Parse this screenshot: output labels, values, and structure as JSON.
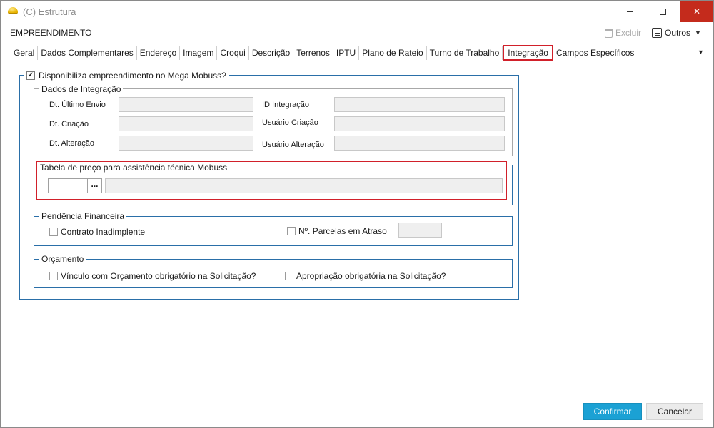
{
  "window": {
    "title": "(C) Estrutura",
    "controls": {
      "minimize": "minimize",
      "maximize": "maximize",
      "close": "✕"
    }
  },
  "header": {
    "entity": "EMPREENDIMENTO",
    "excluir": "Excluir",
    "outros": "Outros"
  },
  "tabs": [
    {
      "label": "Geral"
    },
    {
      "label": "Dados Complementares"
    },
    {
      "label": "Endereço"
    },
    {
      "label": "Imagem"
    },
    {
      "label": "Croqui"
    },
    {
      "label": "Descrição"
    },
    {
      "label": "Terrenos"
    },
    {
      "label": "IPTU"
    },
    {
      "label": "Plano de Rateio"
    },
    {
      "label": "Turno de Trabalho"
    },
    {
      "label": "Integração",
      "active": true
    },
    {
      "label": "Campos Específicos"
    }
  ],
  "main": {
    "mobuss_toggle": {
      "label": "Disponibiliza empreendimento no Mega Mobuss?",
      "checked": true
    },
    "integration": {
      "title": "Dados de Integração",
      "dt_ultimo_envio": {
        "label": "Dt. Último Envio",
        "value": ""
      },
      "dt_criacao": {
        "label": "Dt. Criação",
        "value": ""
      },
      "dt_alteracao": {
        "label": "Dt. Alteração",
        "value": ""
      },
      "id_integracao": {
        "label": "ID Integração",
        "value": ""
      },
      "usuario_criacao": {
        "label": "Usuário Criação",
        "value": ""
      },
      "usuario_alteracao": {
        "label": "Usuário Alteração",
        "value": ""
      }
    },
    "price_table": {
      "title": "Tabela de preço para assistência técnica Mobuss",
      "code": "",
      "lookup_button": "...",
      "description": ""
    },
    "financial": {
      "title": "Pendência Financeira",
      "contrato_inadimplente": {
        "label": "Contrato Inadimplente",
        "checked": false
      },
      "parcelas_atraso": {
        "label": "Nº. Parcelas em Atraso",
        "checked": false,
        "value": ""
      }
    },
    "budget": {
      "title": "Orçamento",
      "vinculo": {
        "label": "Vínculo com Orçamento obrigatório na Solicitação?",
        "checked": false
      },
      "apropriacao": {
        "label": "Apropriação obrigatória na Solicitação?",
        "checked": false
      }
    }
  },
  "footer": {
    "confirmar": "Confirmar",
    "cancelar": "Cancelar"
  },
  "colors": {
    "accent": "#1ba1d4",
    "highlight": "#d1202a",
    "panel_border": "#2a6fa8",
    "close_button": "#c42b1c"
  }
}
